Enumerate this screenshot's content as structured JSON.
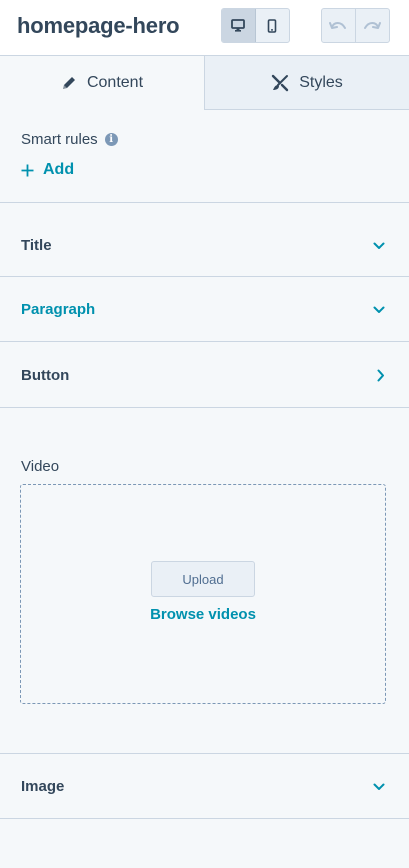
{
  "header": {
    "title": "homepage-hero",
    "device_toggle": {
      "desktop_icon": "desktop-icon",
      "mobile_icon": "mobile-icon",
      "active": "desktop"
    },
    "undo_icon": "undo-icon",
    "redo_icon": "redo-icon"
  },
  "tabs": [
    {
      "label": "Content",
      "icon": "pencil-icon",
      "active": true
    },
    {
      "label": "Styles",
      "icon": "brush-icon",
      "active": false
    }
  ],
  "smart_rules": {
    "label": "Smart rules",
    "info_icon": "info-icon",
    "add_label": "Add"
  },
  "sections": {
    "title": {
      "label": "Title",
      "state": "collapsed"
    },
    "paragraph": {
      "label": "Paragraph",
      "state": "collapsed"
    },
    "button": {
      "label": "Button",
      "state": "collapsed"
    },
    "video": {
      "label": "Video",
      "upload_label": "Upload",
      "browse_label": "Browse videos"
    },
    "image": {
      "label": "Image",
      "state": "collapsed"
    }
  },
  "colors": {
    "accent": "#0091ae",
    "text": "#33475b",
    "border": "#cbd6e2",
    "background": "#f5f8fa"
  }
}
